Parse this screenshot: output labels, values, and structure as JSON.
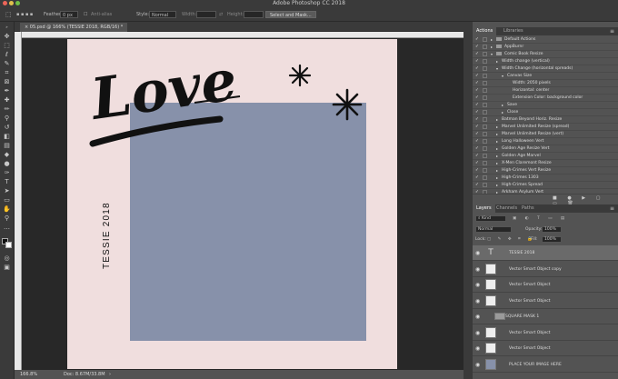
{
  "app": {
    "title": "Adobe Photoshop CC 2018"
  },
  "options": {
    "feather_label": "Feather:",
    "feather_value": "0 px",
    "antialias_label": "Anti-alias",
    "style_label": "Style:",
    "style_value": "Normal",
    "width_label": "Width:",
    "height_label": "Height:",
    "select_mask": "Select and Mask..."
  },
  "document": {
    "tab": "05.psd @ 166% (TESSIE 2018, RGB/16) *",
    "zoom": "166.8%",
    "doc_size": "Doc: 8.67M/33.8M"
  },
  "canvas": {
    "headline": "Love",
    "side_text": "TESSIE 2018",
    "bg_color": "#f0dede",
    "photo_color": "#8791aa",
    "ink_color": "#111111"
  },
  "ruler_ticks": [
    "0",
    "100",
    "200",
    "300",
    "400",
    "500",
    "600",
    "700",
    "800",
    "900",
    "1000",
    "1100",
    "1200",
    "1300",
    "1400",
    "1500",
    "1600",
    "1700",
    "1800",
    "1900",
    "2000",
    "2100",
    "2200"
  ],
  "actions_tabs": [
    "Actions",
    "Libraries"
  ],
  "actions": [
    {
      "label": "Default Actions",
      "indent": 0,
      "folder": true,
      "tri": "▸"
    },
    {
      "label": "AppBurnr",
      "indent": 0,
      "folder": true,
      "tri": "▸"
    },
    {
      "label": "Comic Book Resize",
      "indent": 0,
      "folder": true,
      "tri": "▾"
    },
    {
      "label": "Width change (vertical)",
      "indent": 1,
      "folder": false,
      "tri": "▸"
    },
    {
      "label": "Width Change (horizontal spreads)",
      "indent": 1,
      "folder": false,
      "tri": "▾"
    },
    {
      "label": "Canvas Size",
      "indent": 2,
      "folder": false,
      "tri": "▾"
    },
    {
      "label": "Width: 2050 pixels",
      "indent": 3,
      "folder": false,
      "tri": ""
    },
    {
      "label": "Horizontal: center",
      "indent": 3,
      "folder": false,
      "tri": ""
    },
    {
      "label": "Extension Color: background color",
      "indent": 3,
      "folder": false,
      "tri": ""
    },
    {
      "label": "Save",
      "indent": 2,
      "folder": false,
      "tri": "▸"
    },
    {
      "label": "Close",
      "indent": 2,
      "folder": false,
      "tri": "▸"
    },
    {
      "label": "Batman Beyond Horiz. Resize",
      "indent": 1,
      "folder": false,
      "tri": "▸"
    },
    {
      "label": "Marvel Unlimited Resize (spread)",
      "indent": 1,
      "folder": false,
      "tri": "▸"
    },
    {
      "label": "Marvel Unlimited Resize (vert)",
      "indent": 1,
      "folder": false,
      "tri": "▸"
    },
    {
      "label": "Long Halloween Vert",
      "indent": 1,
      "folder": false,
      "tri": "▸"
    },
    {
      "label": "Golden Age Resize Vert",
      "indent": 1,
      "folder": false,
      "tri": "▸"
    },
    {
      "label": "Golden Age Marvel",
      "indent": 1,
      "folder": false,
      "tri": "▸"
    },
    {
      "label": "X-Men Claremont Resize",
      "indent": 1,
      "folder": false,
      "tri": "▸"
    },
    {
      "label": "High-Crimes Vert Resize",
      "indent": 1,
      "folder": false,
      "tri": "▸"
    },
    {
      "label": "High-Crimes 1303",
      "indent": 1,
      "folder": false,
      "tri": "▸"
    },
    {
      "label": "High-Crimes Spread",
      "indent": 1,
      "folder": false,
      "tri": "▸"
    },
    {
      "label": "Arkham Asylum Vert",
      "indent": 1,
      "folder": false,
      "tri": "▸"
    }
  ],
  "layers_tabs": [
    "Layers",
    "Channels",
    "Paths"
  ],
  "layers_controls": {
    "kind": "Kind",
    "blend": "Normal",
    "opacity_label": "Opacity:",
    "opacity": "100%",
    "lock_label": "Lock:",
    "fill_label": "Fill:",
    "fill": "100%"
  },
  "layers": [
    {
      "name": "TESSIE 2018",
      "type": "text",
      "selected": true
    },
    {
      "name": "Vector Smart Object copy",
      "type": "so",
      "selected": false
    },
    {
      "name": "Vector Smart Object",
      "type": "so",
      "selected": false
    },
    {
      "name": "Vector Smart Object",
      "type": "so",
      "selected": false
    },
    {
      "name": "SQUARE MASK 1",
      "type": "group",
      "selected": false
    },
    {
      "name": "Vector Smart Object",
      "type": "so",
      "selected": false
    },
    {
      "name": "Vector Smart Object",
      "type": "so",
      "selected": false
    },
    {
      "name": "PLACE YOUR IMAGE HERE",
      "type": "image",
      "selected": false
    }
  ]
}
